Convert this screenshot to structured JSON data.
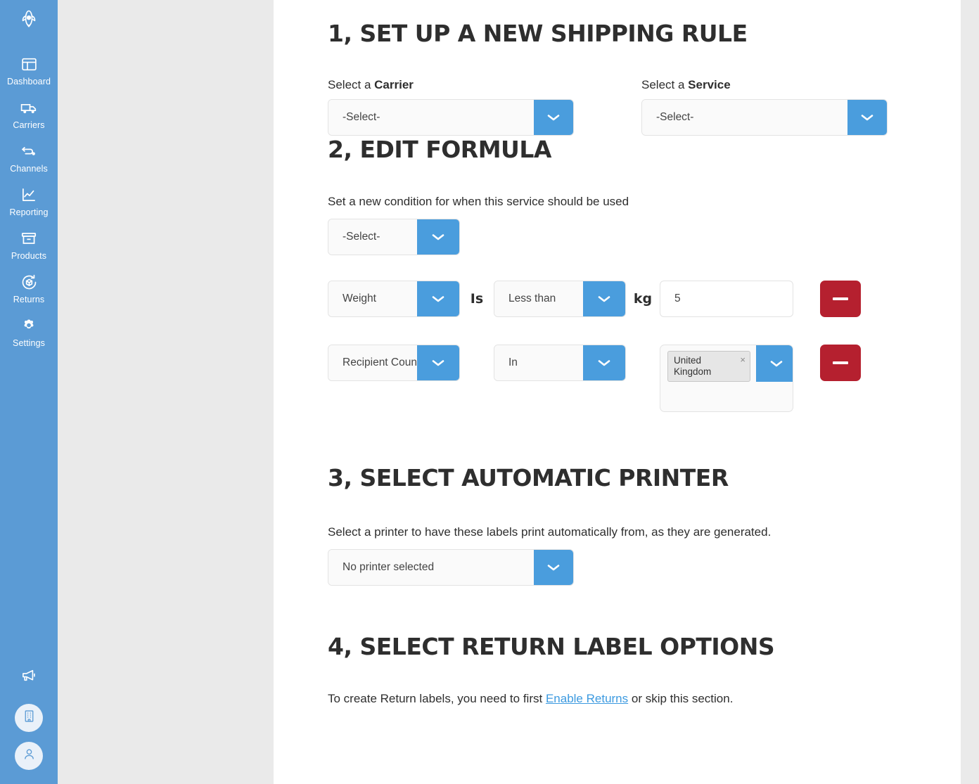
{
  "sidebar": {
    "logo_icon": "rocket-icon",
    "items": [
      {
        "label": "Dashboard",
        "icon": "dashboard-icon"
      },
      {
        "label": "Carriers",
        "icon": "truck-icon"
      },
      {
        "label": "Channels",
        "icon": "channels-icon"
      },
      {
        "label": "Reporting",
        "icon": "chart-icon"
      },
      {
        "label": "Products",
        "icon": "box-icon"
      },
      {
        "label": "Returns",
        "icon": "returns-icon"
      },
      {
        "label": "Settings",
        "icon": "gear-icon"
      }
    ],
    "bottom": {
      "megaphone_icon": "megaphone-icon",
      "company_icon": "building-icon",
      "account_icon": "user-icon"
    }
  },
  "colors": {
    "sidebar_blue": "#5b9bd5",
    "accent_blue": "#4a9ddd",
    "danger_red": "#b5202f",
    "rail_gray": "#eaeaea",
    "link_blue": "#3c9ae0",
    "heading_dark": "#2e2e2e"
  },
  "section1": {
    "title": "1, SET UP A NEW SHIPPING RULE",
    "carrier": {
      "label_prefix": "Select a ",
      "label_strong": "Carrier",
      "value": "-Select-"
    },
    "service": {
      "label_prefix": "Select a ",
      "label_strong": "Service",
      "value": "-Select-"
    }
  },
  "section2": {
    "title": "2, EDIT FORMULA",
    "helper": "Set a new condition for when this service should be used",
    "new_condition_value": "-Select-",
    "conditions": [
      {
        "field": "Weight",
        "operator_label": "Is",
        "comparator": "Less than",
        "unit": "kg",
        "value": "5",
        "type": "number"
      },
      {
        "field": "Recipient Country",
        "operator_label": "",
        "comparator": "In",
        "unit": "",
        "type": "tags",
        "tags": [
          "United Kingdom"
        ],
        "tag_remove_glyph": "×"
      }
    ]
  },
  "section3": {
    "title": "3, SELECT AUTOMATIC PRINTER",
    "helper": "Select a printer to have these labels print automatically from, as they are generated.",
    "printer_value": "No printer selected"
  },
  "section4": {
    "title": "4, SELECT RETURN LABEL OPTIONS",
    "text_before": "To create Return labels, you need to first ",
    "link_text": "Enable Returns",
    "text_after": " or skip this section."
  }
}
